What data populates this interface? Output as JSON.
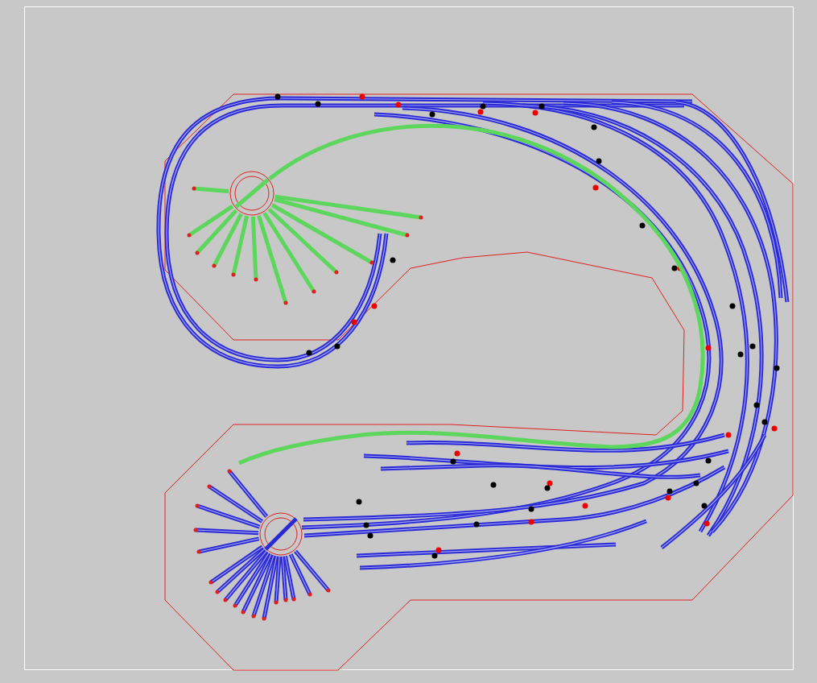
{
  "layout": {
    "layers": [
      {
        "kind": "mainline",
        "color": "#2a2ad6"
      },
      {
        "kind": "siding",
        "color": "#5cd65c"
      }
    ]
  }
}
